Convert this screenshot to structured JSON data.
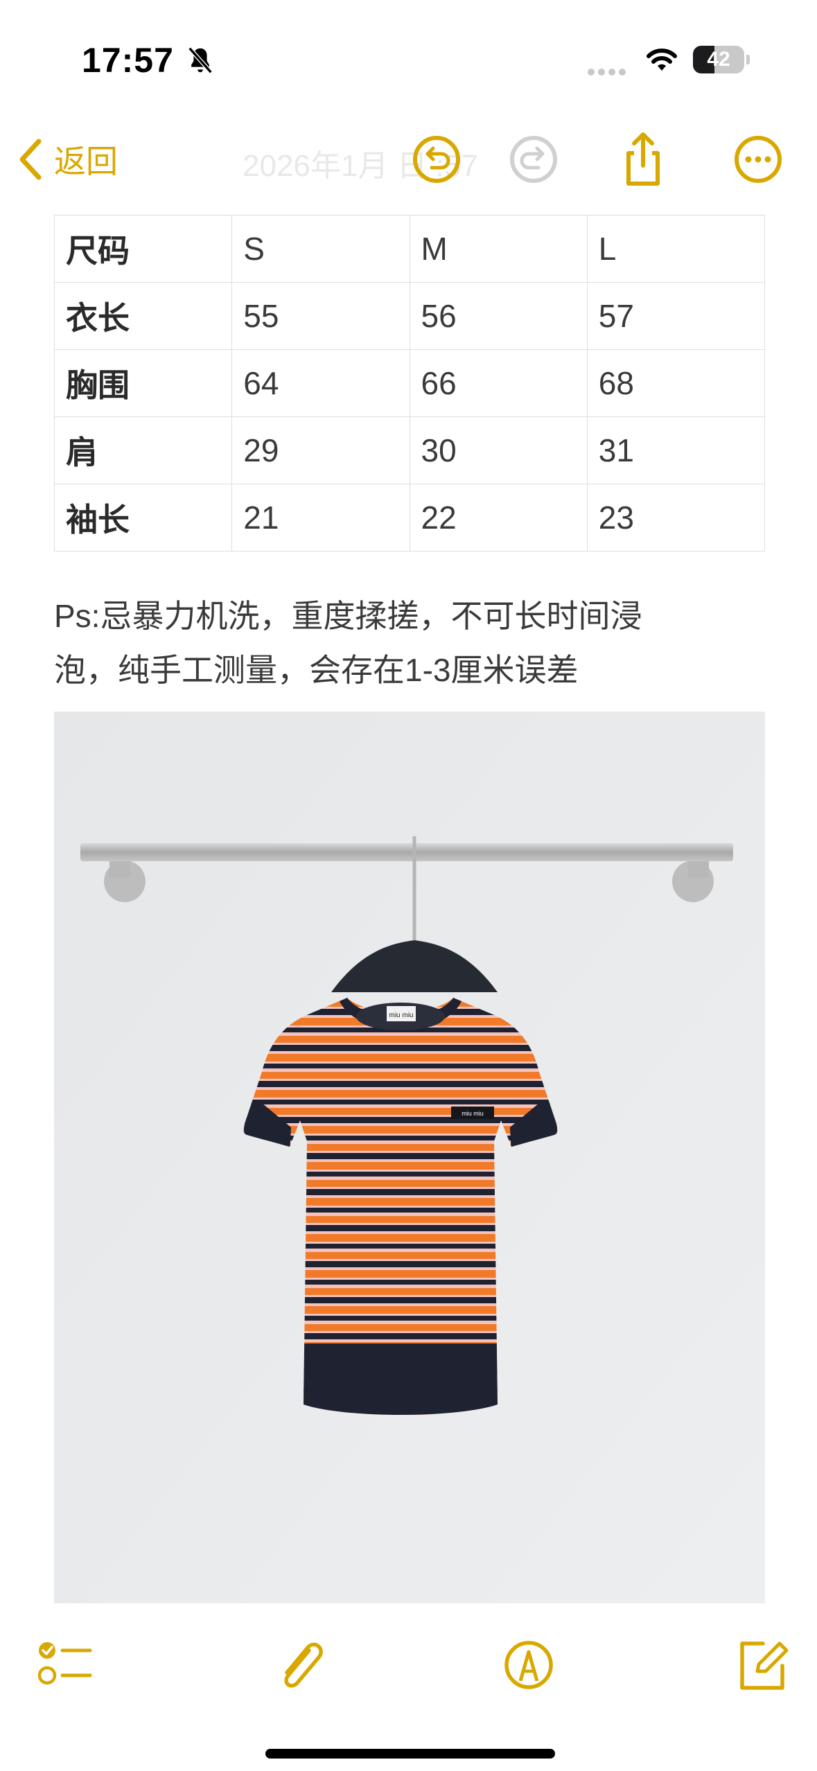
{
  "status_bar": {
    "time": "17:57",
    "battery": "42",
    "battery_level": 0.42,
    "icons": [
      "bell-slash-icon",
      "cellular-signal-icon",
      "wifi-icon",
      "battery-icon"
    ]
  },
  "nav": {
    "back_label": "返回",
    "title": "2026年1月    日    :57",
    "icons": [
      "chevron-left-icon",
      "undo-icon",
      "redo-icon",
      "share-icon",
      "more-icon"
    ],
    "accent_color": "#d9a800"
  },
  "size_table": {
    "headers": [
      "尺码",
      "S",
      "M",
      "L"
    ],
    "rows": [
      [
        "衣长",
        "55",
        "56",
        "57"
      ],
      [
        "胸围",
        "64",
        "66",
        "68"
      ],
      [
        "肩",
        "29",
        "30",
        "31"
      ],
      [
        "袖长",
        "21",
        "22",
        "23"
      ]
    ]
  },
  "note": {
    "line1": "Ps:忌暴力机洗，重度揉搓，不可长时间浸",
    "line2": "泡，纯手工测量，会存在1-3厘米误差"
  },
  "photo": {
    "label_text": "miu miu",
    "patch_text": "miu miu",
    "stripe_colors": [
      "#f07a2a",
      "#f4c3bd",
      "#1f2230"
    ]
  },
  "toolbar": {
    "icons": [
      "checklist-icon",
      "paperclip-icon",
      "markup-pen-icon",
      "compose-icon"
    ]
  }
}
